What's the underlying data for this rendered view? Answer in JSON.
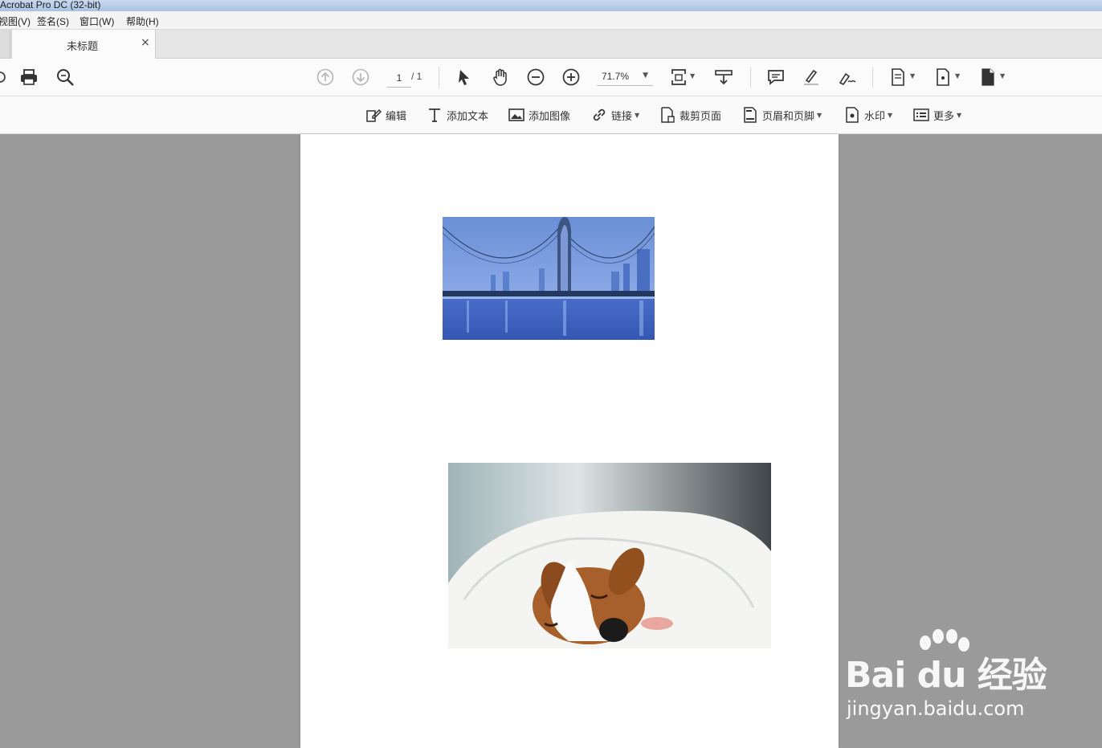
{
  "window": {
    "title": "Acrobat Pro DC (32-bit)"
  },
  "menu": {
    "items": [
      "视图(V)",
      "签名(S)",
      "窗口(W)",
      "帮助(H)"
    ]
  },
  "tab": {
    "title": "未标题",
    "close_glyph": "×"
  },
  "toolbar": {
    "page_current": "1",
    "page_total": "/ 1",
    "zoom": "71.7%",
    "icons": [
      "share-icon",
      "print-icon",
      "search-icon",
      "prev-page-icon",
      "next-page-icon",
      "select-cursor-icon",
      "hand-icon",
      "zoom-out-icon",
      "zoom-in-icon",
      "fit-page-icon",
      "scroll-mode-icon",
      "comment-icon",
      "highlight-icon",
      "sign-icon",
      "export-icon",
      "create-icon",
      "organize-icon"
    ]
  },
  "edit_toolbar": {
    "edit": "编辑",
    "add_text": "添加文本",
    "add_image": "添加图像",
    "link": "链接",
    "crop": "裁剪页面",
    "header_footer": "页眉和页脚",
    "watermark": "水印",
    "more": "更多"
  },
  "document": {
    "images": [
      "city-bridge-night-photo",
      "sleeping-puppy-photo"
    ]
  },
  "watermark": {
    "brand": "Bai du 经验",
    "url": "jingyan.baidu.com"
  },
  "colors": {
    "canvas_bg": "#9a9a9a",
    "toolbar_bg": "#fbfbfb",
    "tab_bg": "#e6e6e6",
    "titlebar": "#b9cde9"
  }
}
